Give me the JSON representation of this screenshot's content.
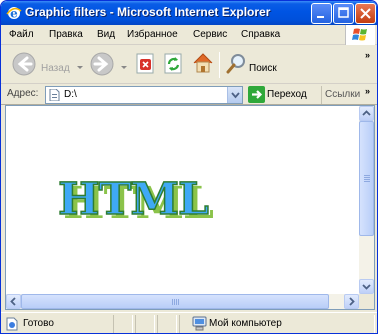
{
  "window": {
    "title": "Graphic filters - Microsoft Internet Explorer"
  },
  "menu": {
    "items": [
      "Файл",
      "Правка",
      "Вид",
      "Избранное",
      "Сервис",
      "Справка"
    ]
  },
  "toolbar": {
    "back_label": "Назад",
    "search_label": "Поиск"
  },
  "address": {
    "label": "Адрес:",
    "value": "D:\\",
    "go_label": "Переход",
    "links_label": "Ссылки"
  },
  "page": {
    "art_text": "HTML",
    "colors": {
      "art_fill": "#3FA9F5",
      "art_outline": "#2E7D32",
      "art_shadow": "#8BC34A"
    }
  },
  "statusbar": {
    "status_text": "Готово",
    "zone_text": "Мой компьютер"
  }
}
